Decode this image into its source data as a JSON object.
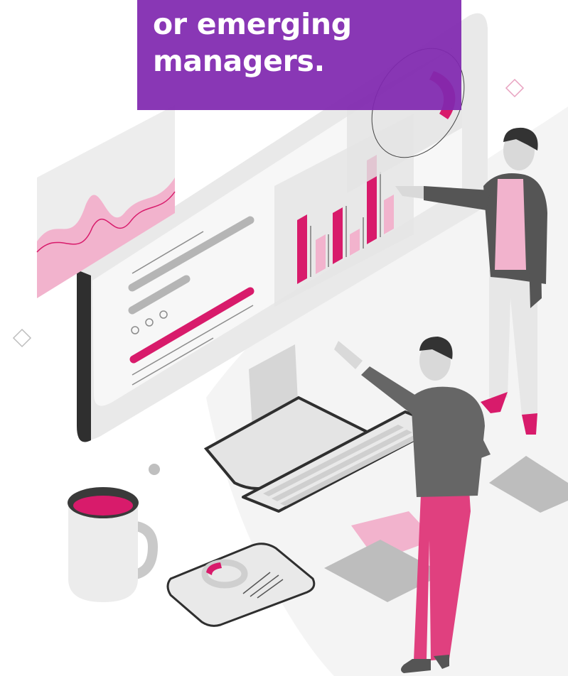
{
  "headline": {
    "lines": [
      "or emerging",
      "managers."
    ]
  },
  "colors": {
    "banner": "#8028af",
    "accent_magenta": "#d81b6b",
    "accent_pink": "#f2b3cd",
    "skin_gray": "#d9d9d9",
    "shirt_dark": "#555555",
    "pants_pink": "#e0407f"
  },
  "illustration": {
    "scene": "two-people-analytics-dashboard",
    "elements": [
      "monitor",
      "bar-chart-panel",
      "wave-chart-panel",
      "donut-chart-panel",
      "keyboard",
      "coffee-mug",
      "phone",
      "person-standing-pointing",
      "person-reaching"
    ]
  }
}
